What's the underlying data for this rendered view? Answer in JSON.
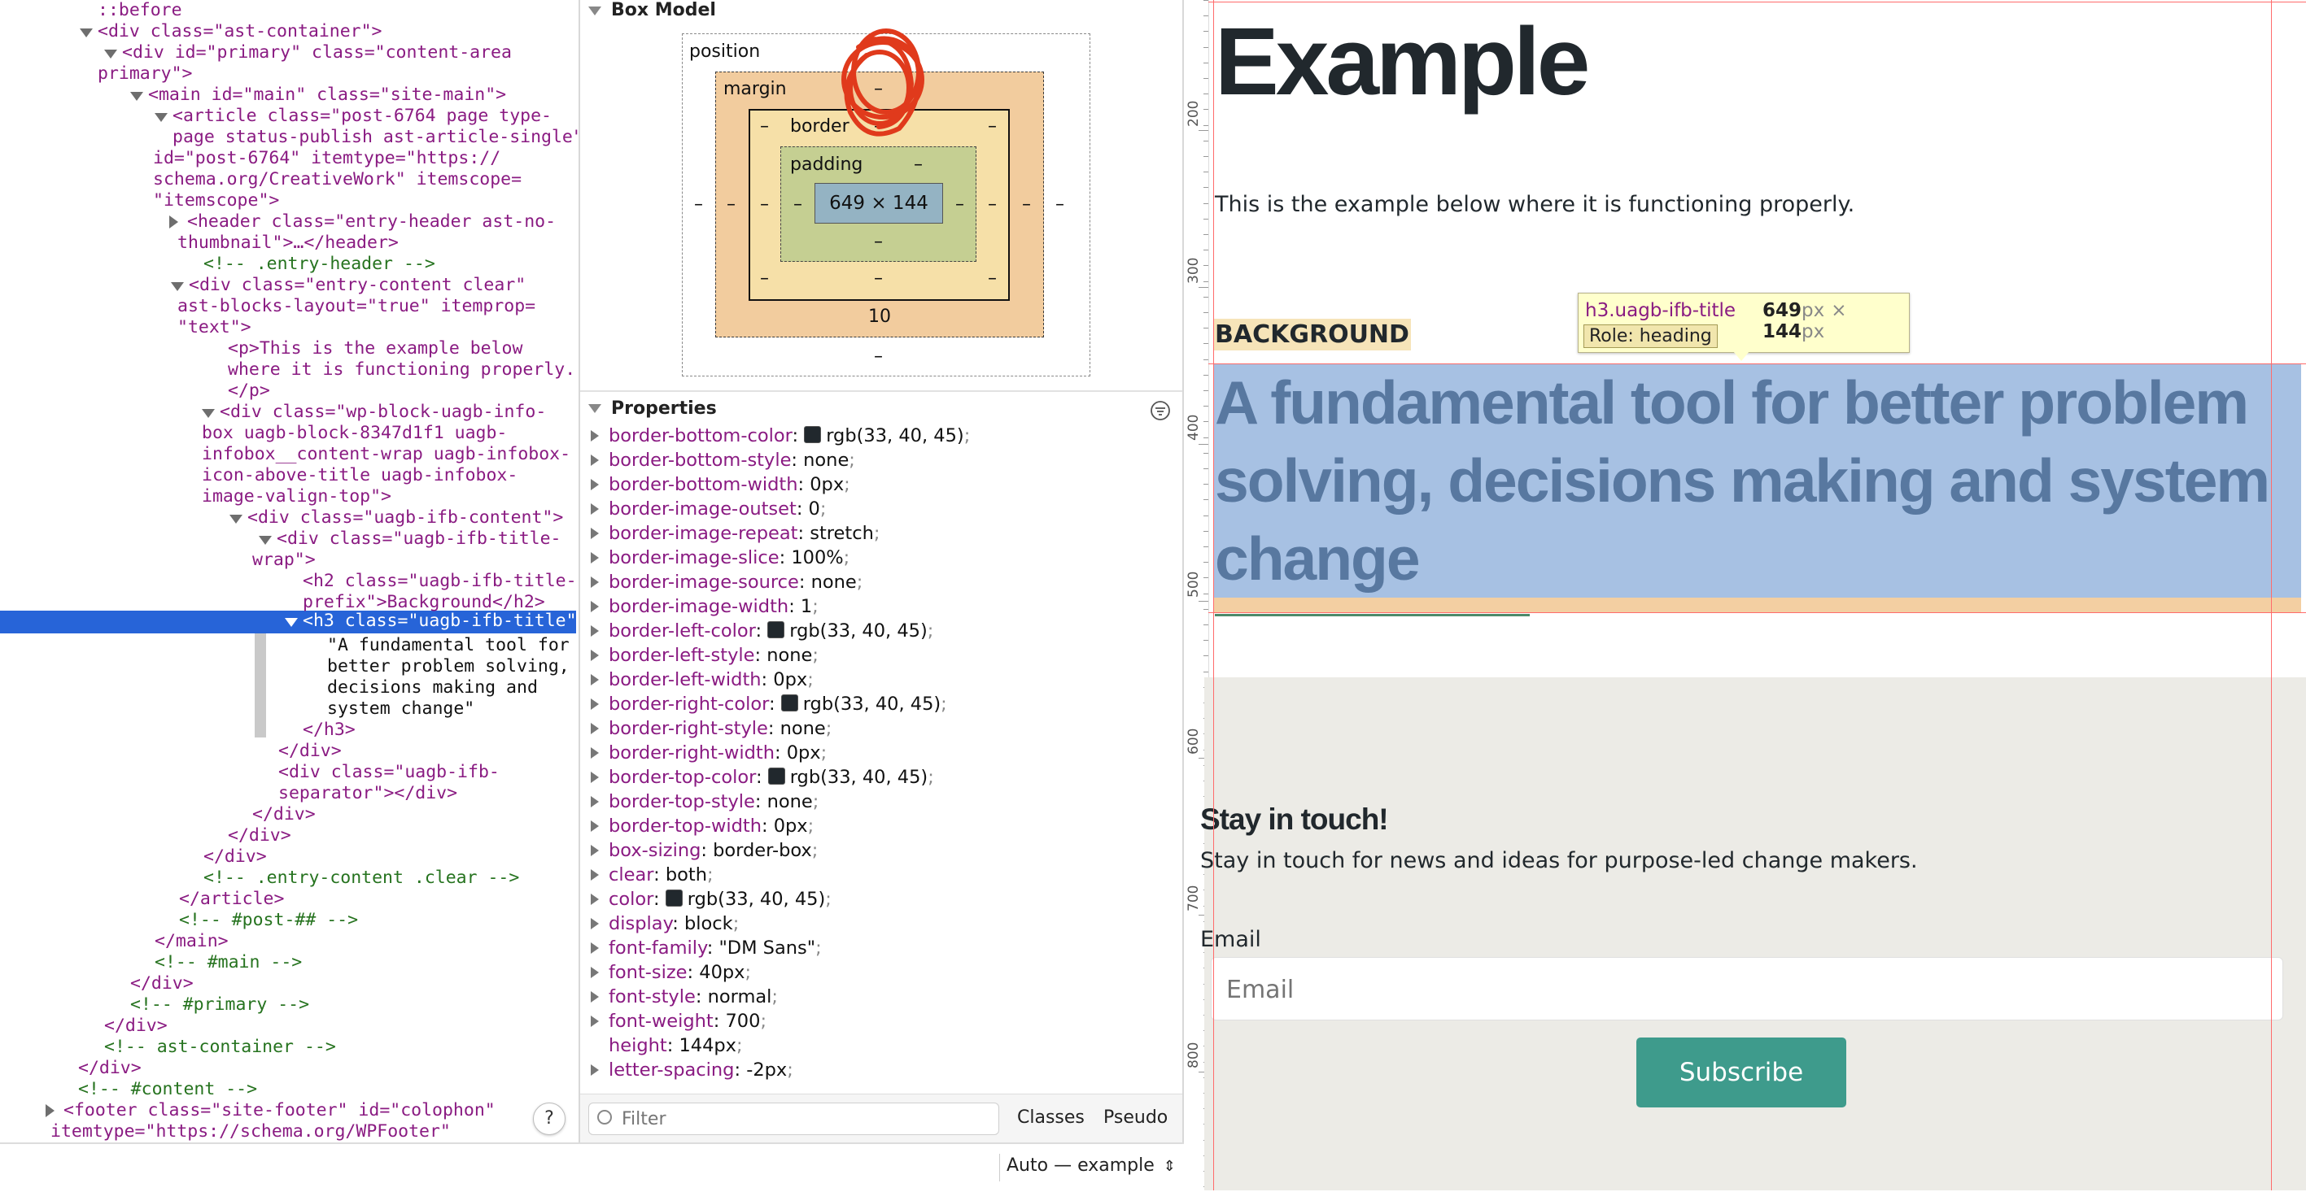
{
  "dom": {
    "lines": [
      {
        "text": "::before",
        "cls": "ps"
      },
      {
        "text": "<div class=\"ast-container\">"
      },
      {
        "text": "<div id=\"primary\" class=\"content-area"
      },
      {
        "text": "primary\">"
      },
      {
        "text": "<main id=\"main\" class=\"site-main\">"
      },
      {
        "text": "<article class=\"post-6764 page type-"
      },
      {
        "text": "page status-publish ast-article-single\""
      },
      {
        "text": "id=\"post-6764\" itemtype=\"https://"
      },
      {
        "text": "schema.org/CreativeWork\" itemscope="
      },
      {
        "text": "\"itemscope\">"
      },
      {
        "text": "<header class=\"entry-header ast-no-"
      },
      {
        "text": "thumbnail\">…</header>"
      },
      {
        "text": "<!-- .entry-header -->",
        "cls": "c"
      },
      {
        "text": "<div class=\"entry-content clear\""
      },
      {
        "text": "ast-blocks-layout=\"true\" itemprop="
      },
      {
        "text": "\"text\">"
      },
      {
        "text": "<p>This is the example below"
      },
      {
        "text": "where it is functioning properly."
      },
      {
        "text": "</p>"
      },
      {
        "text": "<div class=\"wp-block-uagb-info-"
      },
      {
        "text": "box uagb-block-8347d1f1 uagb-"
      },
      {
        "text": "infobox__content-wrap uagb-infobox-"
      },
      {
        "text": "icon-above-title uagb-infobox-"
      },
      {
        "text": "image-valign-top\">"
      },
      {
        "text": "<div class=\"uagb-ifb-content\">"
      },
      {
        "text": "<div class=\"uagb-ifb-title-"
      },
      {
        "text": "wrap\">"
      },
      {
        "text": "<h2 class=\"uagb-ifb-title-"
      },
      {
        "text": "prefix\">Background</h2>"
      },
      {
        "text": "<h3 class=\"uagb-ifb-title\">",
        "selected": true
      },
      {
        "text": "\"A fundamental tool for",
        "cls": "x"
      },
      {
        "text": "better problem solving,",
        "cls": "x"
      },
      {
        "text": "decisions making and",
        "cls": "x"
      },
      {
        "text": "system change\"",
        "cls": "x"
      },
      {
        "text": "</h3>"
      },
      {
        "text": "</div>"
      },
      {
        "text": "<div class=\"uagb-ifb-"
      },
      {
        "text": "separator\"></div>"
      },
      {
        "text": "</div>"
      },
      {
        "text": "</div>"
      },
      {
        "text": "</div>"
      },
      {
        "text": "<!-- .entry-content .clear -->",
        "cls": "c"
      },
      {
        "text": "</article>"
      },
      {
        "text": "<!-- #post-## -->",
        "cls": "c"
      },
      {
        "text": "</main>"
      },
      {
        "text": "<!-- #main -->",
        "cls": "c"
      },
      {
        "text": "</div>"
      },
      {
        "text": "<!-- #primary -->",
        "cls": "c"
      },
      {
        "text": "</div>"
      },
      {
        "text": "<!-- ast-container -->",
        "cls": "c"
      },
      {
        "text": "</div>"
      },
      {
        "text": "<!-- #content -->",
        "cls": "c"
      },
      {
        "text": "<footer class=\"site-footer\" id=\"colophon\""
      },
      {
        "text": "itemtype=\"https://schema.org/WPFooter\""
      }
    ],
    "help_label": "?"
  },
  "box_model": {
    "section_title": "Box Model",
    "position_label": "position",
    "margin_label": "margin",
    "border_label": "border",
    "padding_label": "padding",
    "content_size": "649 × 144",
    "dash": "–",
    "margin_bottom": "10"
  },
  "properties": {
    "section_title": "Properties",
    "items": [
      {
        "name": "border-bottom-color",
        "value": "rgb(33, 40, 45)",
        "swatch": true
      },
      {
        "name": "border-bottom-style",
        "value": "none"
      },
      {
        "name": "border-bottom-width",
        "value": "0px"
      },
      {
        "name": "border-image-outset",
        "value": "0"
      },
      {
        "name": "border-image-repeat",
        "value": "stretch"
      },
      {
        "name": "border-image-slice",
        "value": "100%"
      },
      {
        "name": "border-image-source",
        "value": "none"
      },
      {
        "name": "border-image-width",
        "value": "1"
      },
      {
        "name": "border-left-color",
        "value": "rgb(33, 40, 45)",
        "swatch": true
      },
      {
        "name": "border-left-style",
        "value": "none"
      },
      {
        "name": "border-left-width",
        "value": "0px"
      },
      {
        "name": "border-right-color",
        "value": "rgb(33, 40, 45)",
        "swatch": true
      },
      {
        "name": "border-right-style",
        "value": "none"
      },
      {
        "name": "border-right-width",
        "value": "0px"
      },
      {
        "name": "border-top-color",
        "value": "rgb(33, 40, 45)",
        "swatch": true
      },
      {
        "name": "border-top-style",
        "value": "none"
      },
      {
        "name": "border-top-width",
        "value": "0px"
      },
      {
        "name": "box-sizing",
        "value": "border-box"
      },
      {
        "name": "clear",
        "value": "both"
      },
      {
        "name": "color",
        "value": "rgb(33, 40, 45)",
        "swatch": true
      },
      {
        "name": "display",
        "value": "block"
      },
      {
        "name": "font-family",
        "value": "\"DM Sans\""
      },
      {
        "name": "font-size",
        "value": "40px"
      },
      {
        "name": "font-style",
        "value": "normal"
      },
      {
        "name": "font-weight",
        "value": "700"
      },
      {
        "name": "height",
        "value": "144px",
        "notri": true
      },
      {
        "name": "letter-spacing",
        "value": "-2px"
      }
    ],
    "filter_placeholder": "Filter",
    "classes_label": "Classes",
    "pseudo_label": "Pseudo"
  },
  "bottom": {
    "mode_label": "Auto — example"
  },
  "page": {
    "title": "Example",
    "intro": "This is the example below where it is functioning properly.",
    "prefix": "BACKGROUND",
    "heading": "A fundamental tool for better problem solving, decisions making and system change",
    "tooltip": {
      "tag": "h3",
      "cls": ".uagb-ifb-title",
      "width": "649",
      "height": "144",
      "unit": "px",
      "times": "×",
      "role": "Role: heading"
    },
    "ruler_labels": [
      "200",
      "300",
      "400",
      "500",
      "600",
      "700",
      "800"
    ],
    "footer": {
      "title": "Stay in touch!",
      "text": "Stay in touch for news and ideas for purpose-led change makers.",
      "email_label": "Email",
      "email_placeholder": "Email",
      "button": "Subscribe"
    }
  },
  "colors": {
    "selection": "#2764d8",
    "tag": "#8a1b82",
    "attr_value": "#1c1cb8",
    "comment": "#26731f",
    "heading_highlight": "#a7c1e3",
    "subscribe": "#3e9b8c"
  }
}
